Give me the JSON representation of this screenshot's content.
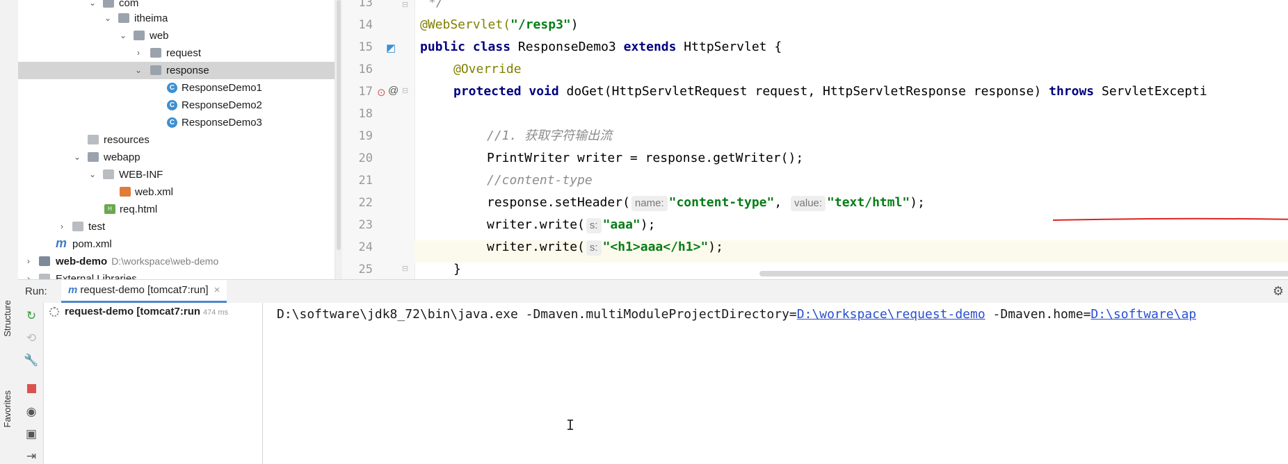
{
  "sidebar": {
    "structure_label": "Structure",
    "favorites_label": "Favorites"
  },
  "project_tree": {
    "items": [
      {
        "label": "com",
        "icon": "folder-icon",
        "arrow": "⌄"
      },
      {
        "label": "itheima",
        "icon": "folder-icon",
        "arrow": "⌄"
      },
      {
        "label": "web",
        "icon": "folder-icon",
        "arrow": "⌄"
      },
      {
        "label": "request",
        "icon": "folder-icon",
        "arrow": "›"
      },
      {
        "label": "response",
        "icon": "folder-icon",
        "arrow": "⌄",
        "selected": true
      },
      {
        "label": "ResponseDemo1",
        "icon": "java-class-icon"
      },
      {
        "label": "ResponseDemo2",
        "icon": "java-class-icon"
      },
      {
        "label": "ResponseDemo3",
        "icon": "java-class-icon"
      },
      {
        "label": "resources",
        "icon": "resources-folder-icon"
      },
      {
        "label": "webapp",
        "icon": "webapp-folder-icon",
        "arrow": "⌄"
      },
      {
        "label": "WEB-INF",
        "icon": "folder-icon",
        "arrow": "⌄"
      },
      {
        "label": "web.xml",
        "icon": "xml-file-icon"
      },
      {
        "label": "req.html",
        "icon": "html-file-icon"
      },
      {
        "label": "test",
        "icon": "folder-icon",
        "arrow": "›"
      },
      {
        "label": "pom.xml",
        "icon": "maven-icon"
      },
      {
        "label": "web-demo",
        "path": "D:\\workspace\\web-demo",
        "icon": "module-icon",
        "arrow": "›"
      },
      {
        "label": "External Libraries",
        "icon": "library-icon",
        "arrow": "›"
      }
    ]
  },
  "editor": {
    "line_numbers": [
      "13",
      "14",
      "15",
      "16",
      "17",
      "18",
      "19",
      "20",
      "21",
      "22",
      "23",
      "24",
      "25"
    ],
    "code": {
      "l13": "*/",
      "l14_ann": "@WebServlet(",
      "l14_str": "\"/resp3\"",
      "l14_end": ")",
      "l15_kw1": "public class",
      "l15_name": " ResponseDemo3 ",
      "l15_kw2": "extends",
      "l15_rest": " HttpServlet {",
      "l16_ann": "@Override",
      "l17_kw": "protected void",
      "l17_rest": " doGet(HttpServletRequest request, HttpServletResponse response) ",
      "l17_kw2": "throws",
      "l17_tail": " ServletExcepti",
      "l19_cmt": "//1. 获取字符输出流",
      "l20": "PrintWriter writer = response.getWriter();",
      "l21_cmt": "//content-type",
      "l22_start": "response.setHeader(",
      "l22_hint1": "name:",
      "l22_str1": "\"content-type\"",
      "l22_comma": ", ",
      "l22_hint2": "value:",
      "l22_str2": "\"text/html\"",
      "l22_end": ");",
      "l23_start": "writer.write(",
      "l23_hint": "s:",
      "l23_str": "\"aaa\"",
      "l23_end": ");",
      "l24_start": "writer.write(",
      "l24_hint": "s:",
      "l24_str": "\"<h1>aaa</h1>\"",
      "l24_end": ");",
      "l25": "}"
    }
  },
  "run_panel": {
    "label": "Run:",
    "tab_label": "request-demo [tomcat7:run]",
    "tab_close": "×",
    "tree_item": "request-demo [tomcat7:run",
    "tree_time": "474 ms",
    "console": {
      "prefix": "D:\\software\\jdk8_72\\bin\\java.exe -Dmaven.multiModuleProjectDirectory=",
      "link1": "D:\\workspace\\request-demo",
      "middle": " -Dmaven.home=",
      "link2": "D:\\software\\ap"
    }
  },
  "colors": {
    "keyword": "#000080",
    "string": "#067d17",
    "annotation": "#808000",
    "comment": "#8c8c8c",
    "link": "#2a4fcf",
    "selection": "#d4d4d4"
  }
}
